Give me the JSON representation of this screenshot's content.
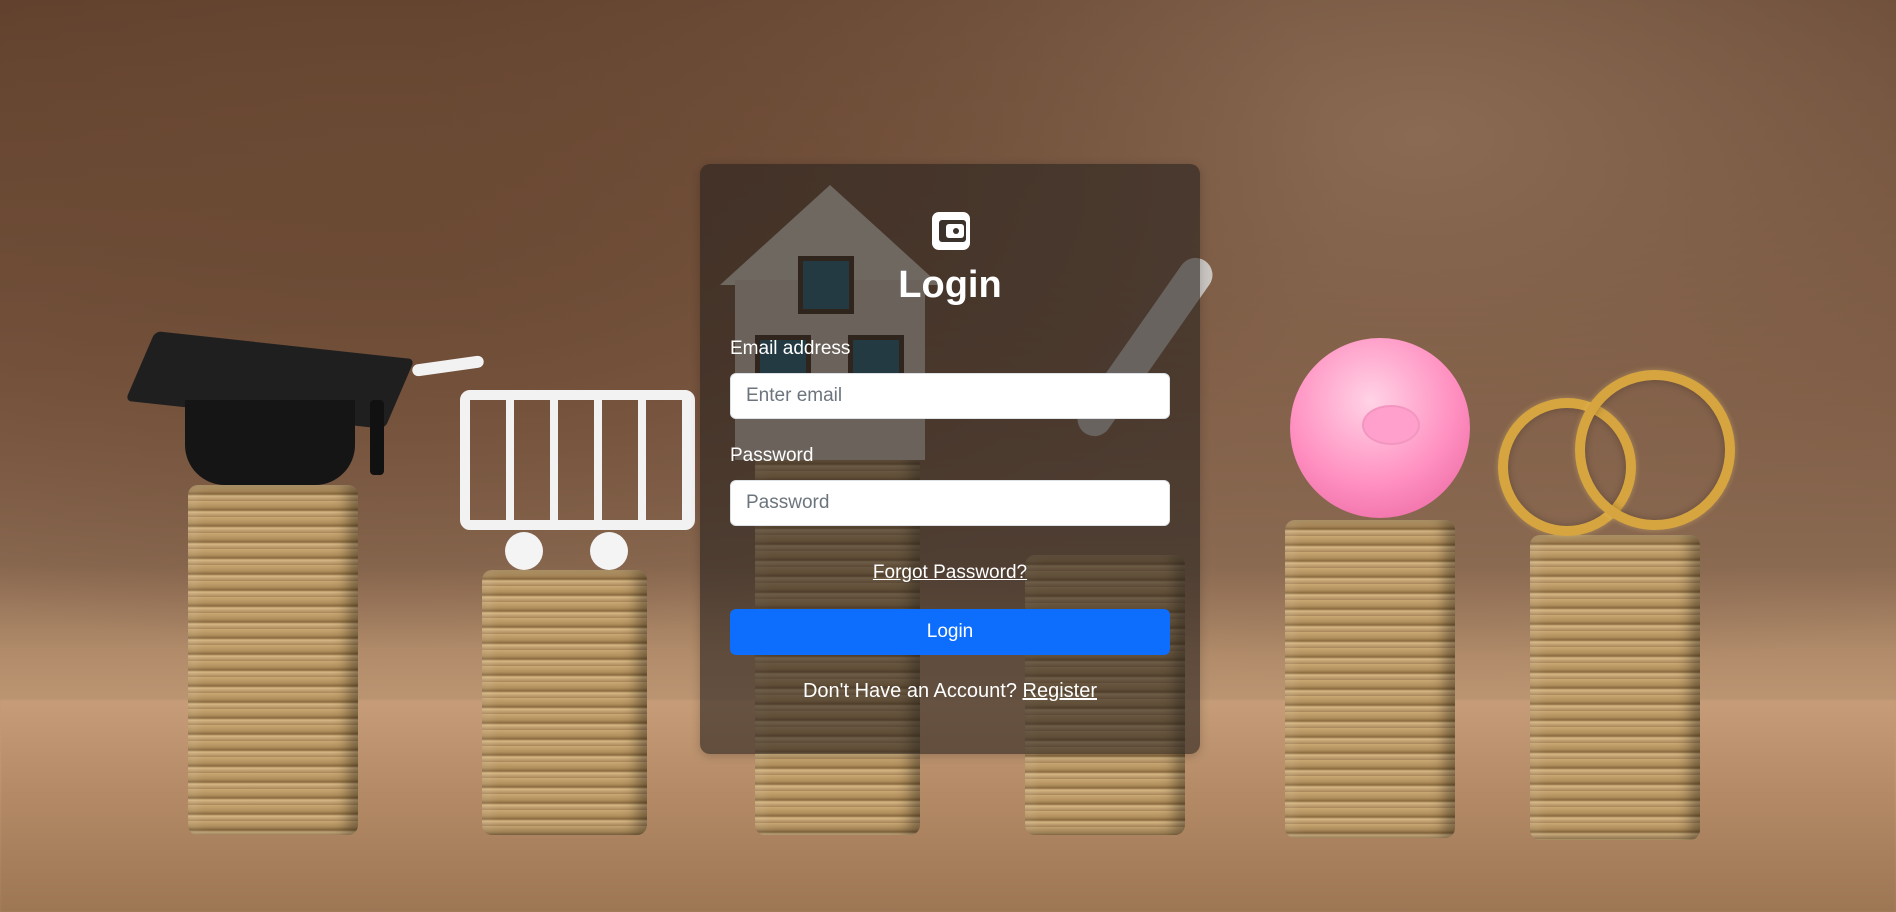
{
  "colors": {
    "primary": "#0d6efd",
    "overlay": "#28221e",
    "text": "#ffffff"
  },
  "brand": {
    "icon": "wallet-icon"
  },
  "login": {
    "title": "Login",
    "email_label": "Email address",
    "email_placeholder": "Enter email",
    "email_value": "",
    "password_label": "Password",
    "password_placeholder": "Password",
    "password_value": "",
    "forgot_label": "Forgot Password?",
    "submit_label": "Login",
    "register_prompt": "Don't Have an Account?",
    "register_label": "Register"
  }
}
